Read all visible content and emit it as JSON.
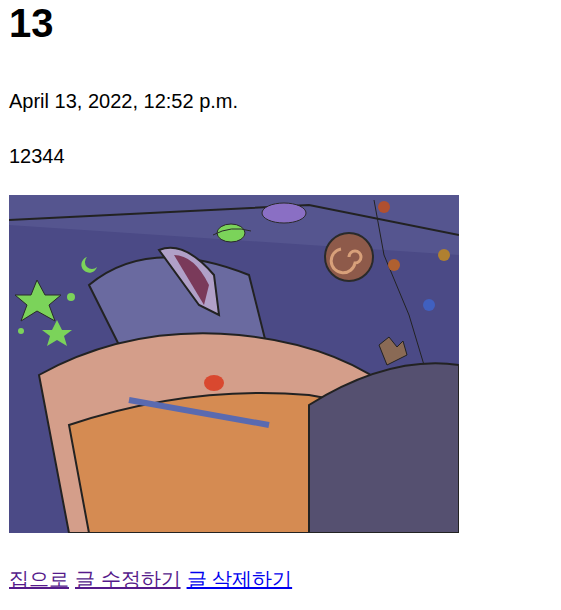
{
  "post": {
    "title": "13",
    "date": "April 13, 2022, 12:52 p.m.",
    "body": "12344"
  },
  "links": [
    {
      "label": "집으로",
      "visited": true
    },
    {
      "label": "글 수정하기",
      "visited": true
    },
    {
      "label": "글 삭제하기",
      "visited": false
    }
  ]
}
